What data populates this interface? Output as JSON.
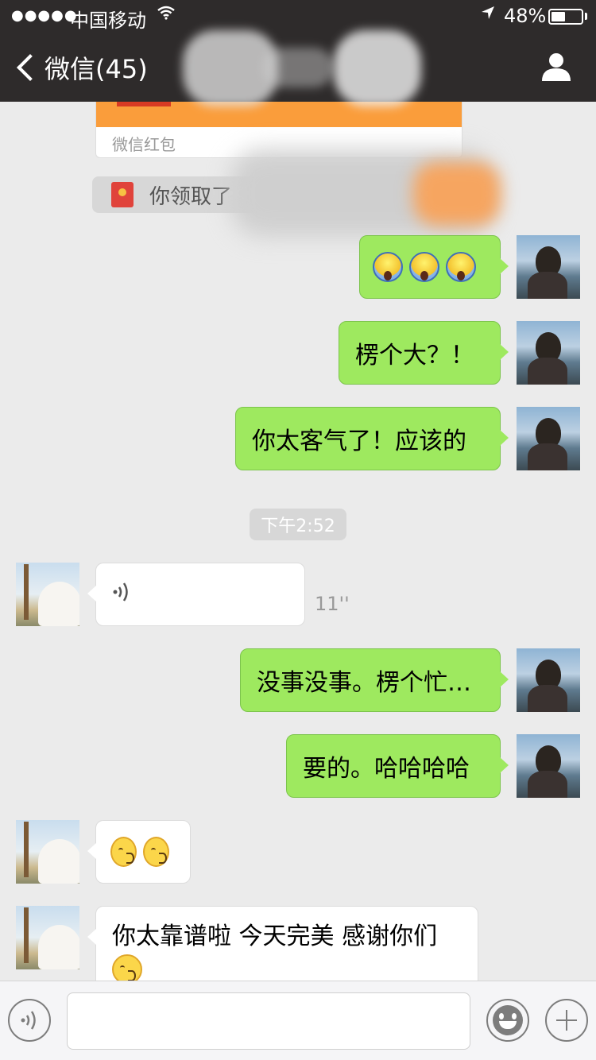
{
  "status_bar": {
    "signal": "●●●●●",
    "carrier": "中国移动",
    "battery_percent": "48%",
    "battery_level": 0.48
  },
  "nav": {
    "back_label": "微信(45)"
  },
  "chat": {
    "red_packet_label": "微信红包",
    "system_notice": "你领取了",
    "messages_right": [
      {
        "text": "楞个大？！"
      },
      {
        "text": "你太客气了！应该的"
      }
    ],
    "time_separator": "下午2:52",
    "voice_duration": "11''",
    "messages_right_2": [
      {
        "text": "没事没事。楞个忙…"
      },
      {
        "text": "要的。哈哈哈哈"
      }
    ],
    "long_message": "你太靠谱啦 今天完美 感谢你们",
    "emoji_icons": {
      "scream": "face-screaming-in-fear-icon",
      "kiss": "kissing-face-icon"
    }
  },
  "input": {
    "placeholder": ""
  },
  "colors": {
    "nav_bg": "#2e2b2b",
    "chat_bg": "#ebebeb",
    "my_bubble": "#9ee95f",
    "their_bubble": "#ffffff",
    "red_packet_orange": "#fa9d3b"
  }
}
